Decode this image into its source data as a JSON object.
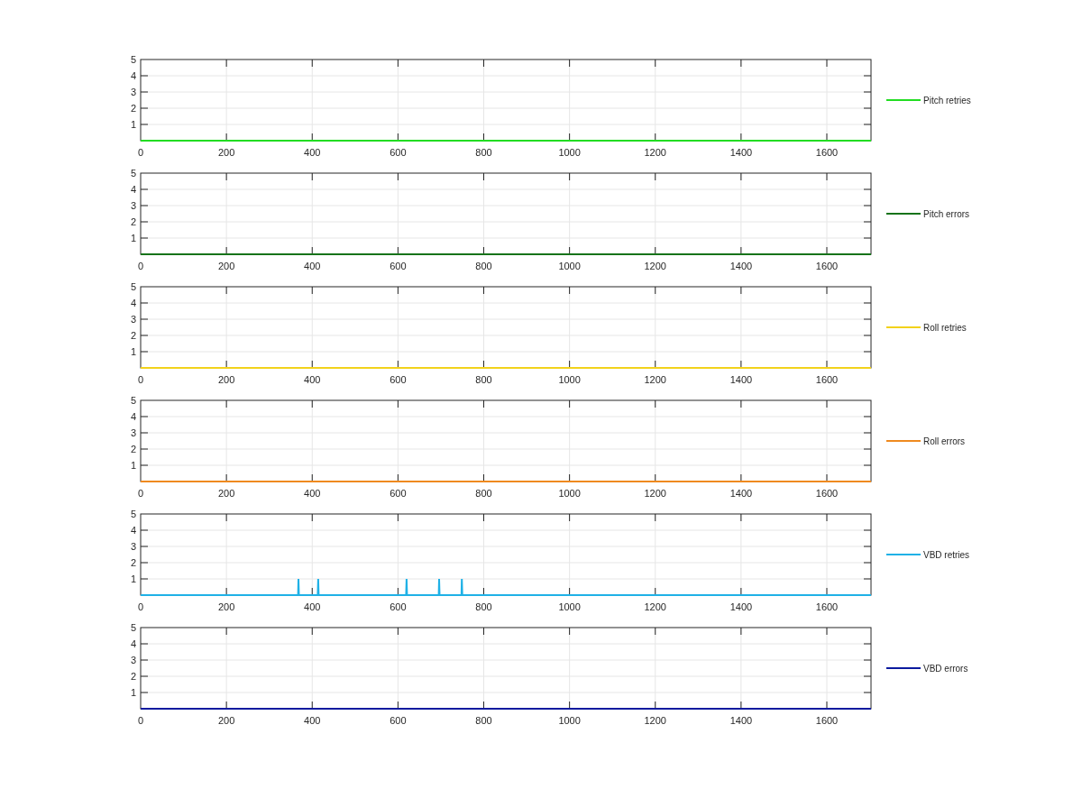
{
  "figure": {
    "subplots": [
      {
        "chart_data": {
          "type": "line",
          "x": [
            0,
            1703
          ],
          "series": [
            {
              "name": "Pitch retries",
              "color": "#22dd22",
              "values": [
                0,
                0
              ]
            }
          ],
          "xlim": [
            0,
            1703
          ],
          "ylim": [
            0,
            5
          ],
          "xticks": [
            0,
            200,
            400,
            600,
            800,
            1000,
            1200,
            1400,
            1600
          ],
          "yticks": [
            1,
            2,
            3,
            4,
            5
          ],
          "grid": true
        }
      },
      {
        "chart_data": {
          "type": "line",
          "x": [
            0,
            1703
          ],
          "series": [
            {
              "name": "Pitch errors",
              "color": "#17731a",
              "values": [
                0,
                0
              ]
            }
          ],
          "xlim": [
            0,
            1703
          ],
          "ylim": [
            0,
            5
          ],
          "xticks": [
            0,
            200,
            400,
            600,
            800,
            1000,
            1200,
            1400,
            1600
          ],
          "yticks": [
            1,
            2,
            3,
            4,
            5
          ],
          "grid": true
        }
      },
      {
        "chart_data": {
          "type": "line",
          "x": [
            0,
            1703
          ],
          "series": [
            {
              "name": "Roll retries",
              "color": "#f2d21b",
              "values": [
                0,
                0
              ]
            }
          ],
          "xlim": [
            0,
            1703
          ],
          "ylim": [
            0,
            5
          ],
          "xticks": [
            0,
            200,
            400,
            600,
            800,
            1000,
            1200,
            1400,
            1600
          ],
          "yticks": [
            1,
            2,
            3,
            4,
            5
          ],
          "grid": true
        }
      },
      {
        "chart_data": {
          "type": "line",
          "x": [
            0,
            1703
          ],
          "series": [
            {
              "name": "Roll errors",
              "color": "#ef8a1f",
              "values": [
                0,
                0
              ]
            }
          ],
          "xlim": [
            0,
            1703
          ],
          "ylim": [
            0,
            5
          ],
          "xticks": [
            0,
            200,
            400,
            600,
            800,
            1000,
            1200,
            1400,
            1600
          ],
          "yticks": [
            1,
            2,
            3,
            4,
            5
          ],
          "grid": true
        }
      },
      {
        "chart_data": {
          "type": "line",
          "x": [
            0,
            367,
            368,
            369,
            413,
            414,
            415,
            619,
            620,
            621,
            695,
            696,
            697,
            748,
            749,
            750,
            1703
          ],
          "series": [
            {
              "name": "VBD retries",
              "color": "#1fb1e6",
              "values": [
                0,
                0,
                1,
                0,
                0,
                1,
                0,
                0,
                1,
                0,
                0,
                1,
                0,
                0,
                1,
                0,
                0
              ]
            }
          ],
          "xlim": [
            0,
            1703
          ],
          "ylim": [
            0,
            5
          ],
          "xticks": [
            0,
            200,
            400,
            600,
            800,
            1000,
            1200,
            1400,
            1600
          ],
          "yticks": [
            1,
            2,
            3,
            4,
            5
          ],
          "grid": true
        }
      },
      {
        "chart_data": {
          "type": "line",
          "x": [
            0,
            1703
          ],
          "series": [
            {
              "name": "VBD errors",
              "color": "#0b1a9e",
              "values": [
                0,
                0
              ]
            }
          ],
          "xlim": [
            0,
            1703
          ],
          "ylim": [
            0,
            5
          ],
          "xticks": [
            0,
            200,
            400,
            600,
            800,
            1000,
            1200,
            1400,
            1600
          ],
          "yticks": [
            1,
            2,
            3,
            4,
            5
          ],
          "grid": true
        }
      }
    ]
  }
}
